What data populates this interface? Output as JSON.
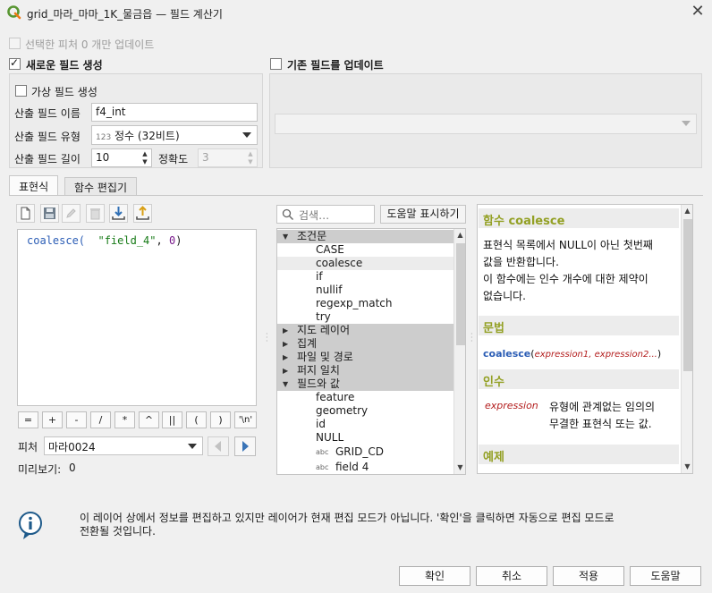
{
  "window": {
    "title": "grid_마라_마마_1K_물금읍 — 필드 계산기",
    "close_icon": "close-icon"
  },
  "top": {
    "update_selected_label": "선택한 피처 0 개만 업데이트",
    "create_new_field_label": "새로운 필드 생성",
    "update_existing_field_label": "기존 필드를 업데이트"
  },
  "new_field": {
    "virtual_label": "가상 필드 생성",
    "name_label": "산출 필드 이름",
    "name_value": "f4_int",
    "type_label": "산출 필드 유형",
    "type_badge": "123",
    "type_value": "정수 (32비트)",
    "length_label": "산출 필드 길이",
    "length_value": "10",
    "precision_label": "정확도",
    "precision_value": "3"
  },
  "tabs": {
    "expression": "표현식",
    "function_editor": "함수 편집기"
  },
  "editor": {
    "code_fn": "coalesce(",
    "code_str": "\"field_4\"",
    "code_sep": ", ",
    "code_num": "0",
    "code_end": ")",
    "operators": [
      "=",
      "+",
      "-",
      "/",
      "*",
      "^",
      "||",
      "(",
      ")",
      "'\\n'"
    ],
    "feature_label": "피처",
    "feature_value": "마라0024",
    "preview_label": "미리보기:",
    "preview_value": "0"
  },
  "search": {
    "placeholder": "검색…",
    "show_help_label": "도움말 표시하기"
  },
  "tree": {
    "group_conditionals": "조건문",
    "conditionals": [
      "CASE",
      "coalesce",
      "if",
      "nullif",
      "regexp_match",
      "try"
    ],
    "groups_collapsed": [
      "지도 레이어",
      "집계",
      "파일 및 경로",
      "퍼지 일치"
    ],
    "group_fields": "필드와 값",
    "fields_plain": [
      "feature",
      "geometry",
      "id",
      "NULL"
    ],
    "fields_typed": [
      {
        "badge": "abc",
        "name": "GRID_CD"
      },
      {
        "badge": "abc",
        "name": "field 4"
      }
    ]
  },
  "help": {
    "title": "함수 coalesce",
    "desc_1": "표현식 목록에서 NULL이 아닌 첫번째",
    "desc_2": "값을 반환합니다.",
    "desc_3": "이 함수에는 인수 개수에 대한 제약이",
    "desc_4": "없습니다.",
    "syntax_heading": "문법",
    "syntax_fn": "coalesce",
    "syntax_open": "(",
    "syntax_args": "expression1, expression2...",
    "syntax_close": ")",
    "args_heading": "인수",
    "arg_name": "expression",
    "arg_desc_1": "유형에 관계없는 임의의",
    "arg_desc_2": "무결한 표현식 또는 값.",
    "examples_heading": "예제"
  },
  "message": {
    "line_1": "이 레이어 상에서 정보를 편집하고 있지만 레이어가 현재 편집 모드가 아닙니다. '확인'을 클릭하면 자동으로 편집 모드로",
    "line_2": "전환될 것입니다."
  },
  "buttons": {
    "ok": "확인",
    "cancel": "취소",
    "apply": "적용",
    "help": "도움말"
  },
  "colors": {
    "help_heading": "#93a024",
    "code_function": "#2b5db5",
    "code_string": "#167a16",
    "qgis_green": "#589632"
  }
}
